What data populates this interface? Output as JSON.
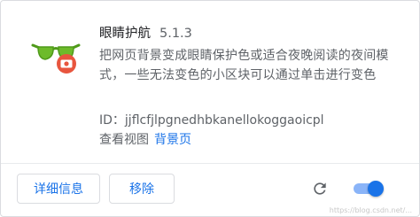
{
  "extension": {
    "name": "眼睛护航",
    "version": "5.1.3",
    "description": "把网页背景变成眼睛保护色或适合夜晚阅读的夜间模式，一些无法变色的小区块可以通过单击进行变色",
    "id_label": "ID：",
    "id_value": "jjflcfjlpgnedhbkanellokoggaoicpl",
    "inspect_views_label": "查看视图",
    "background_page_link": "背景页",
    "icon": "sunglasses-eye-icon",
    "enabled": true
  },
  "actions": {
    "details_label": "详细信息",
    "remove_label": "移除",
    "reload_icon": "reload-icon"
  },
  "watermark": "https://blog.csdn.net/...",
  "colors": {
    "accent": "#1a73e8",
    "toggle_track": "#8ab4f8",
    "text_primary": "#202124",
    "text_secondary": "#5f6368",
    "border": "#dadce0",
    "icon_green": "#6dbb2a",
    "icon_red": "#e8553e"
  }
}
